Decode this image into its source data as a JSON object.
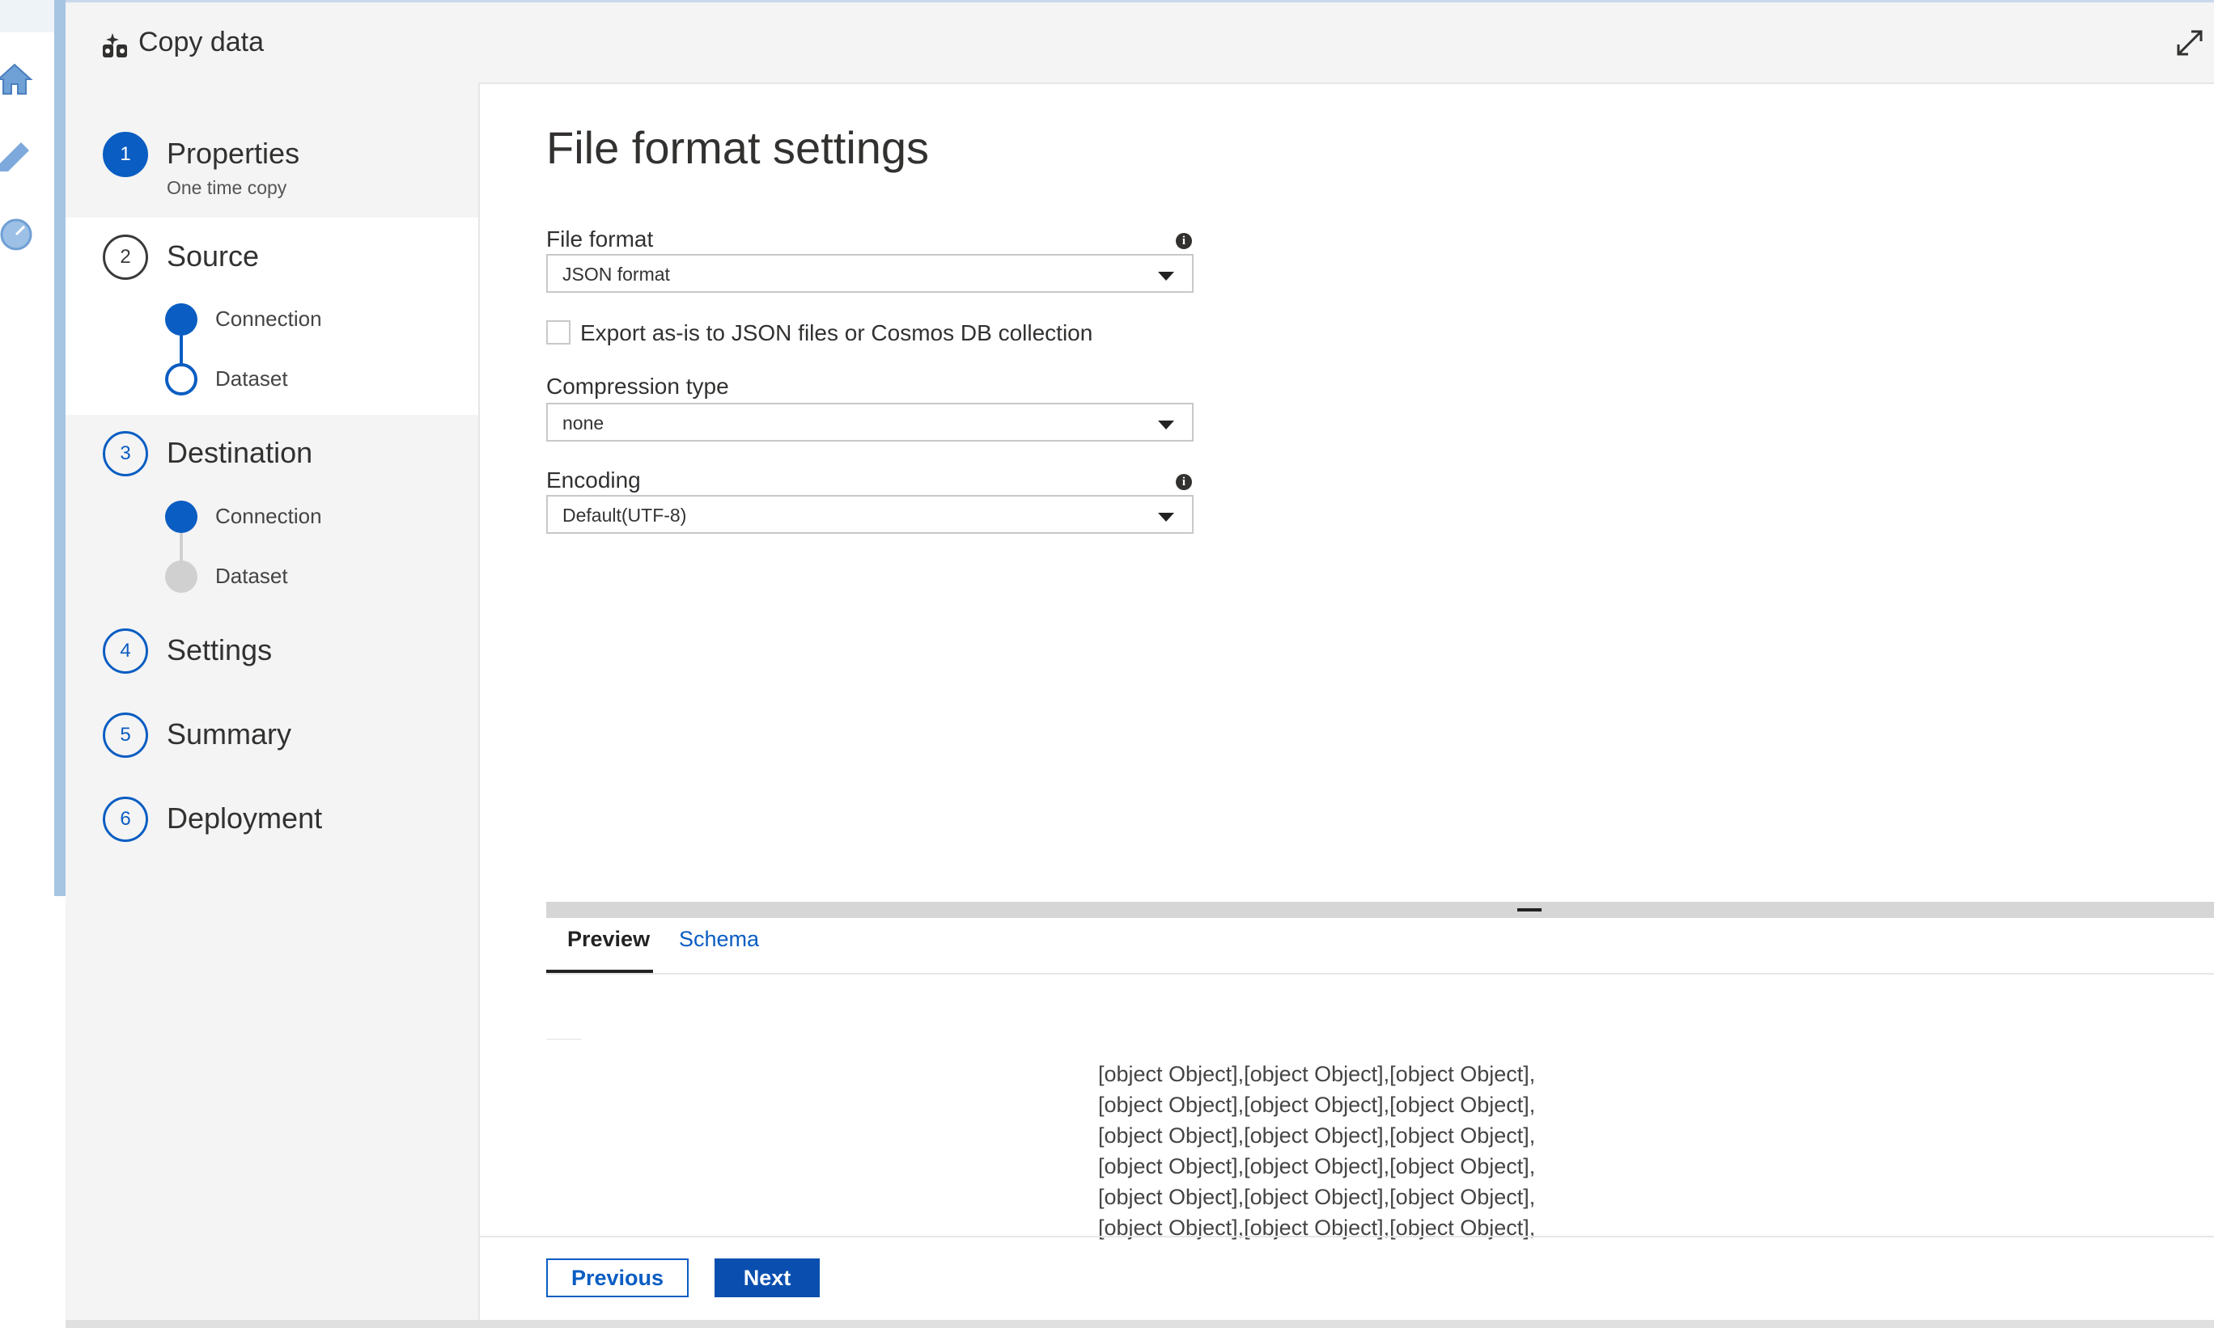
{
  "wizard": {
    "title": "Copy data"
  },
  "steps": [
    {
      "number": "1",
      "title": "Properties",
      "subtitle": "One time copy"
    },
    {
      "number": "2",
      "title": "Source",
      "substeps": [
        "Connection",
        "Dataset"
      ]
    },
    {
      "number": "3",
      "title": "Destination",
      "substeps": [
        "Connection",
        "Dataset"
      ]
    },
    {
      "number": "4",
      "title": "Settings"
    },
    {
      "number": "5",
      "title": "Summary"
    },
    {
      "number": "6",
      "title": "Deployment"
    }
  ],
  "main": {
    "heading": "File format settings",
    "file_format": {
      "label": "File format",
      "value": "JSON format"
    },
    "export_checkbox": {
      "label": "Export as-is to JSON files or Cosmos DB collection",
      "checked": false
    },
    "compression": {
      "label": "Compression type",
      "value": "none"
    },
    "encoding": {
      "label": "Encoding",
      "value": "Default(UTF-8)"
    },
    "tabs": [
      "Preview",
      "Schema"
    ],
    "preview_lines": [
      "[object Object],[object Object],[object Object],",
      "[object Object],[object Object],[object Object],",
      "[object Object],[object Object],[object Object],",
      "[object Object],[object Object],[object Object],",
      "[object Object],[object Object],[object Object],",
      "[object Object],[object Object],[object Object],"
    ]
  },
  "footer": {
    "previous": "Previous",
    "next": "Next"
  },
  "colors": {
    "accent": "#0a5dc2",
    "primary_button": "#0a4fb0",
    "inactive_dot": "#d0d0d0"
  },
  "icons": [
    "home-icon",
    "pencil-icon",
    "monitor-icon",
    "copy-data-icon",
    "expand-icon",
    "info-icon",
    "chevron-down-icon"
  ]
}
